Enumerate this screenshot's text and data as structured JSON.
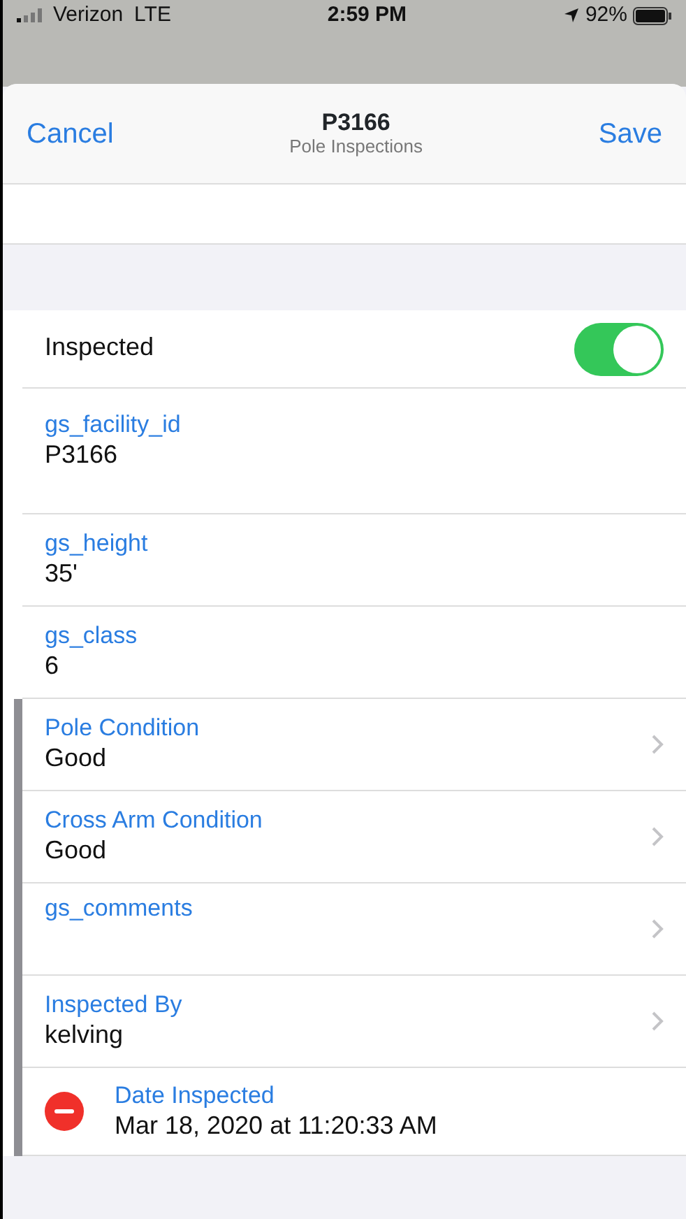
{
  "status_bar": {
    "carrier": "Verizon",
    "network": "LTE",
    "time": "2:59 PM",
    "battery": "92%"
  },
  "sheet": {
    "cancel": "Cancel",
    "title": "P3166",
    "subtitle": "Pole Inspections",
    "save": "Save"
  },
  "rows": [
    {
      "kind": "toggle",
      "label": "Inspected",
      "on": true,
      "edge_bar": false
    },
    {
      "kind": "field",
      "label": "gs_facility_id",
      "value": "P3166",
      "edge_bar": false
    },
    {
      "kind": "field",
      "label": "gs_height",
      "value": "35'",
      "edge_bar": false
    },
    {
      "kind": "field",
      "label": "gs_class",
      "value": "6",
      "edge_bar": false
    },
    {
      "kind": "picker",
      "label": "Pole Condition",
      "value": "Good",
      "edge_bar": true
    },
    {
      "kind": "picker",
      "label": "Cross Arm Condition",
      "value": "Good",
      "edge_bar": true
    },
    {
      "kind": "picker",
      "label": "gs_comments",
      "edge_bar": true
    },
    {
      "kind": "picker",
      "label": "Inspected By",
      "value": "kelving",
      "edge_bar": true
    },
    {
      "kind": "date",
      "label": "Date Inspected",
      "value": "Mar 18, 2020 at 11:20:33 AM",
      "edge_bar": true
    }
  ]
}
